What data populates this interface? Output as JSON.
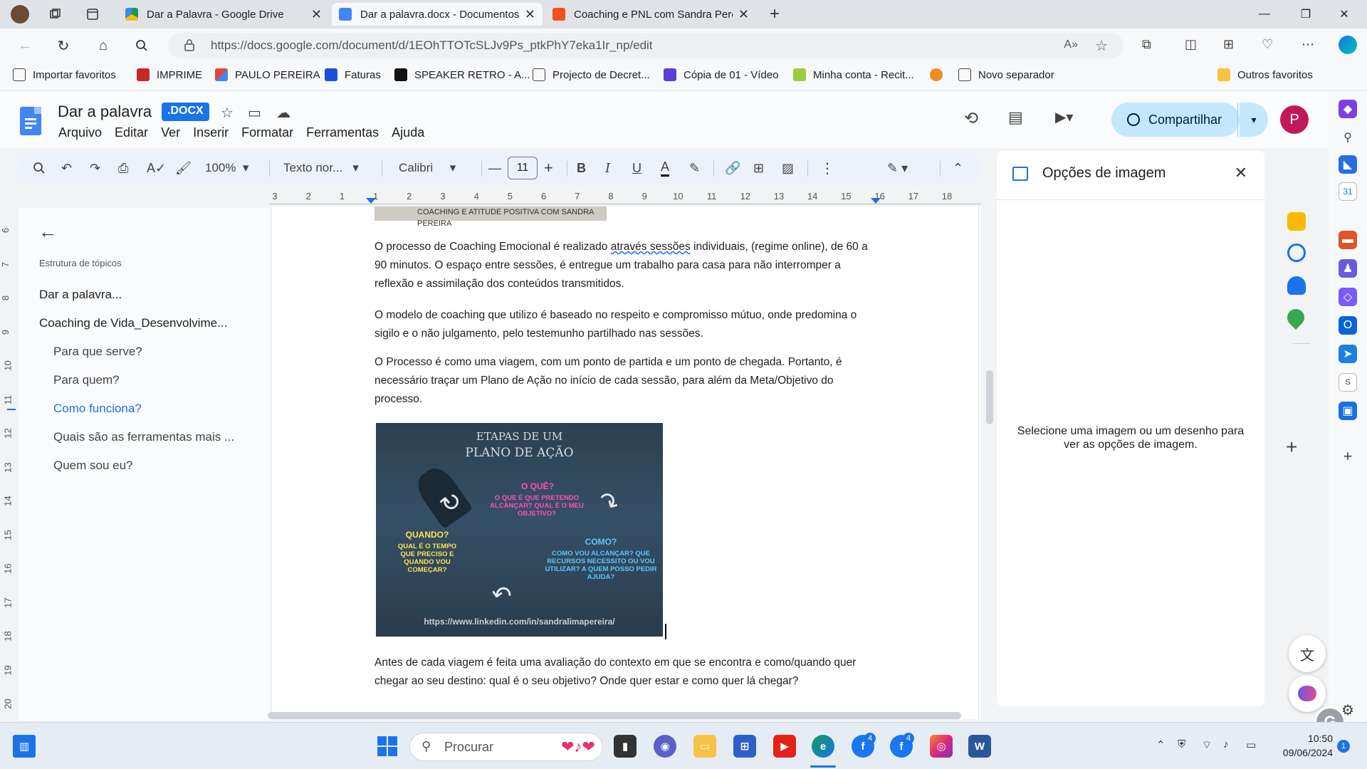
{
  "browser": {
    "tabs": [
      {
        "title": "Dar a Palavra - Google Drive",
        "active": false,
        "color": "#4285f4"
      },
      {
        "title": "Dar a palavra.docx - Documentos",
        "active": true,
        "color": "#4285f4"
      },
      {
        "title": "Coaching e PNL com Sandra Pereira",
        "active": false,
        "color": "#f4511e"
      }
    ],
    "url": "https://docs.google.com/document/d/1EOhTTOTcSLJv9Ps_ptkPhY7eka1Ir_np/edit",
    "bookmarks": [
      "Importar favoritos",
      "IMPRIME",
      "PAULO PEREIRA",
      "Faturas",
      "SPEAKER RETRO - A...",
      "Projecto de Decret...",
      "Cópia de 01 - Vídeo",
      "Minha conta - Recit...",
      "Novo separador"
    ],
    "other_favorites": "Outros favoritos"
  },
  "docs": {
    "title": "Dar a palavra",
    "badge": ".DOCX",
    "menu": [
      "Arquivo",
      "Editar",
      "Ver",
      "Inserir",
      "Formatar",
      "Ferramentas",
      "Ajuda"
    ],
    "share_label": "Compartilhar",
    "avatar_letter": "P",
    "toolbar": {
      "zoom": "100%",
      "style": "Texto nor...",
      "font": "Calibri",
      "font_size": "11"
    },
    "ruler_numbers": [
      "3",
      "2",
      "1",
      "1",
      "2",
      "3",
      "4",
      "5",
      "6",
      "7",
      "8",
      "9",
      "10",
      "11",
      "12",
      "13",
      "14",
      "15",
      "16",
      "17",
      "18"
    ],
    "vruler_numbers": [
      "6",
      "7",
      "8",
      "9",
      "10",
      "11",
      "12",
      "13",
      "14",
      "15",
      "16",
      "17",
      "18",
      "19",
      "20"
    ]
  },
  "outline": {
    "heading": "Estrutura de tópicos",
    "items": [
      {
        "label": "Dar a palavra..."
      },
      {
        "label": "Coaching de Vida_Desenvolvime..."
      },
      {
        "label": "Para que serve?"
      },
      {
        "label": "Para quem?"
      },
      {
        "label": "Como funciona?"
      },
      {
        "label": "Quais são as ferramentas mais ..."
      },
      {
        "label": "Quem sou eu?"
      }
    ]
  },
  "document": {
    "banner": "COACHING E ATITUDE POSITIVA COM SANDRA PEREIRA",
    "p1a": " O processo de Coaching Emocional é realizado ",
    "p1b": "através sessões",
    "p1c": " individuais, (regime online), de 60 a 90 minutos. O espaço entre sessões, é entregue um trabalho para casa para não interromper a reflexão e assimilação dos conteúdos transmitidos.",
    "p2": "O modelo de coaching que utilizo é baseado no respeito e compromisso mútuo, onde predomina o sigilo e o não julgamento, pelo testemunho partilhado nas sessões.",
    "p3": " O Processo é como uma viagem, com um ponto de partida e um ponto de chegada. Portanto, é necessário traçar um Plano de Ação no início de cada sessão, para além da Meta/Objetivo do processo.",
    "p4": "Antes de cada viagem é feita uma avaliação do contexto em que se encontra e como/quando quer chegar ao seu destino: qual é o seu objetivo? Onde quer estar e como quer lá chegar?",
    "poster": {
      "title1": "ETAPAS DE UM",
      "title2": "PLANO DE AÇÃO",
      "what_h": "O QUÊ?",
      "what_b": "O QUE É QUE PRETENDO ALCANÇAR? QUAL É O MEU OBJETIVO?",
      "when_h": "QUANDO?",
      "when_b": "QUAL É O TEMPO QUE PRECISO E QUANDO VOU COMEÇAR?",
      "how_h": "COMO?",
      "how_b": "COMO VOU ALCANÇAR? QUE RECURSOS NECESSITO OU VOU UTILIZAR? A QUEM POSSO PEDIR AJUDA?",
      "link": "https://www.linkedin.com/in/sandralimapereira/"
    }
  },
  "image_panel": {
    "title": "Opções de imagem",
    "message": "Selecione uma imagem ou um desenho para ver as opções de imagem."
  },
  "taskbar": {
    "search": "Procurar",
    "time": "10:50",
    "date": "09/06/2024",
    "badge_count": "4",
    "notif_count": "1"
  }
}
